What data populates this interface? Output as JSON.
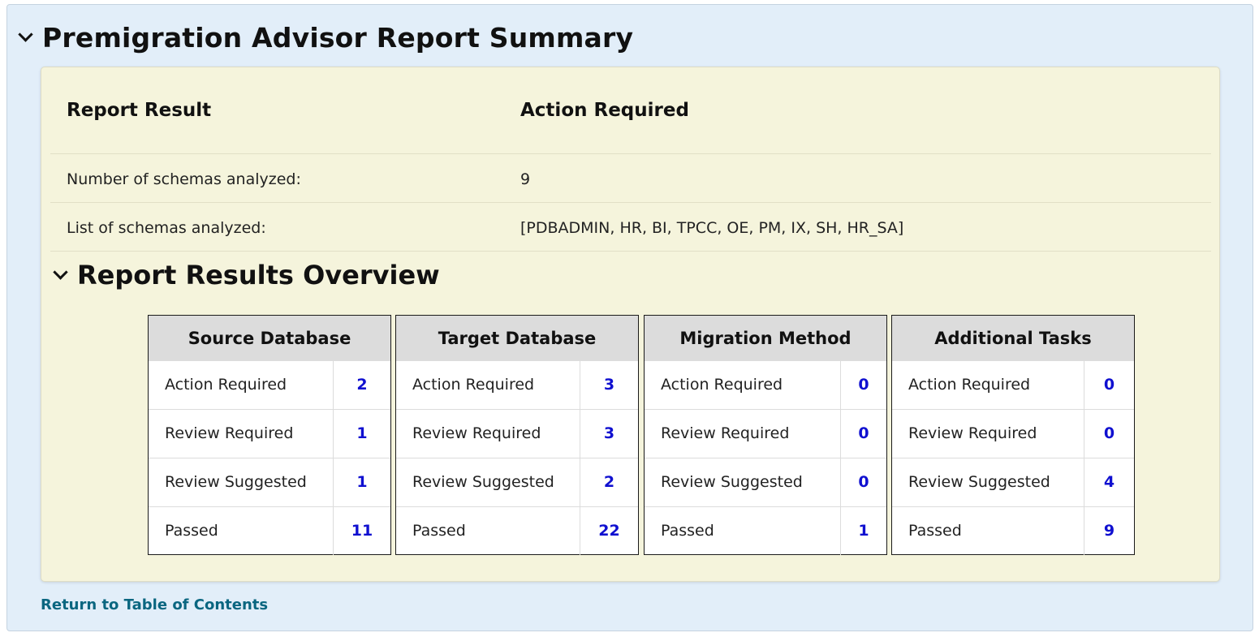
{
  "header": {
    "title": "Premigration Advisor Report Summary"
  },
  "summary": {
    "result_label": "Report Result",
    "result_value": "Action Required",
    "rows": [
      {
        "label": "Number of schemas analyzed:",
        "value": "9"
      },
      {
        "label": "List of schemas analyzed:",
        "value": "[PDBADMIN, HR, BI, TPCC, OE, PM, IX, SH, HR_SA]"
      }
    ]
  },
  "overview": {
    "title": "Report Results Overview",
    "cards": [
      {
        "title": "Source Database",
        "rows": [
          {
            "label": "Action Required",
            "value": "2"
          },
          {
            "label": "Review Required",
            "value": "1"
          },
          {
            "label": "Review Suggested",
            "value": "1"
          },
          {
            "label": "Passed",
            "value": "11"
          }
        ]
      },
      {
        "title": "Target Database",
        "rows": [
          {
            "label": "Action Required",
            "value": "3"
          },
          {
            "label": "Review Required",
            "value": "3"
          },
          {
            "label": "Review Suggested",
            "value": "2"
          },
          {
            "label": "Passed",
            "value": "22"
          }
        ]
      },
      {
        "title": "Migration Method",
        "rows": [
          {
            "label": "Action Required",
            "value": "0"
          },
          {
            "label": "Review Required",
            "value": "0"
          },
          {
            "label": "Review Suggested",
            "value": "0"
          },
          {
            "label": "Passed",
            "value": "1"
          }
        ]
      },
      {
        "title": "Additional Tasks",
        "rows": [
          {
            "label": "Action Required",
            "value": "0"
          },
          {
            "label": "Review Required",
            "value": "0"
          },
          {
            "label": "Review Suggested",
            "value": "4"
          },
          {
            "label": "Passed",
            "value": "9"
          }
        ]
      }
    ]
  },
  "footer": {
    "return_link": "Return to Table of Contents"
  },
  "colors": {
    "outer_background": "#e2eef9",
    "panel_background": "#f5f4dc",
    "count_link": "#1010d0",
    "return_link": "#0a6680"
  }
}
